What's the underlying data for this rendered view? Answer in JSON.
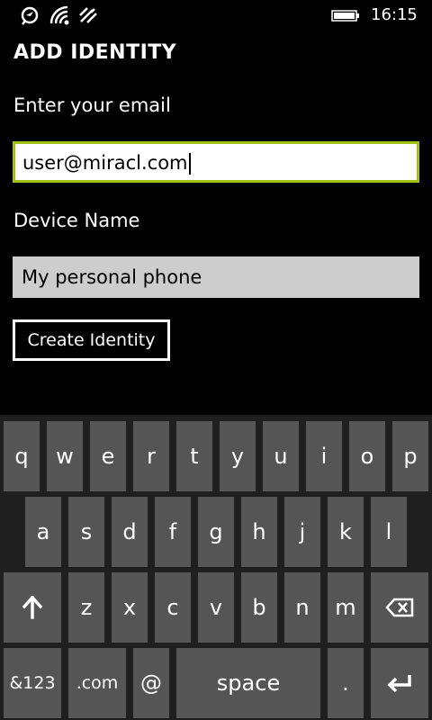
{
  "status_bar": {
    "icons": [
      "location-icon",
      "wifi-icon",
      "data-connection-icon"
    ],
    "battery_icon": "battery-icon",
    "time": "16:15"
  },
  "page": {
    "title": "ADD IDENTITY",
    "email_label": "Enter your email",
    "email_value": "user@miracl.com",
    "device_label": "Device Name",
    "device_value": "My personal phone",
    "create_button": "Create Identity"
  },
  "colors": {
    "background": "#000000",
    "accent_border": "#a4c11a",
    "input_inactive": "#cdcdcd",
    "key": "#555555",
    "keyboard_background": "#1f1f1f"
  },
  "keyboard": {
    "row1": [
      "q",
      "w",
      "e",
      "r",
      "t",
      "y",
      "u",
      "i",
      "o",
      "p"
    ],
    "row2": [
      "a",
      "s",
      "d",
      "f",
      "g",
      "h",
      "j",
      "k",
      "l"
    ],
    "row3": [
      "z",
      "x",
      "c",
      "v",
      "b",
      "n",
      "m"
    ],
    "shift_icon": "shift-arrow-icon",
    "backspace_icon": "backspace-icon",
    "symbols": "&123",
    "dotcom": ".com",
    "at": "@",
    "space": "space",
    "period": ".",
    "enter_icon": "enter-icon"
  }
}
